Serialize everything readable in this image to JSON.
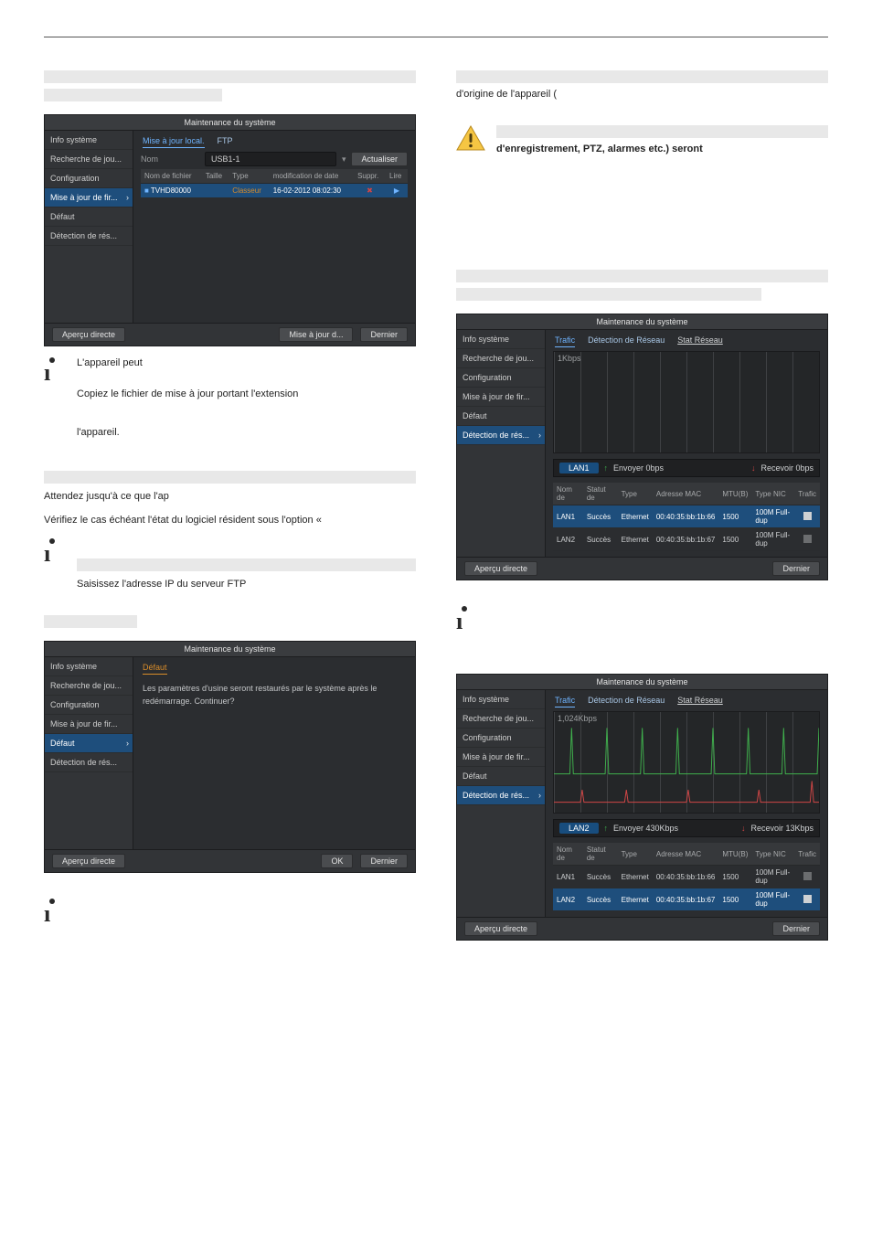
{
  "left": {
    "panel1": {
      "title": "Maintenance du système",
      "sidebar": [
        "Info système",
        "Recherche de jou...",
        "Configuration",
        "Mise à jour de fir...",
        "Défaut",
        "Détection de rés..."
      ],
      "sidebar_active_index": 3,
      "tabs": {
        "local": "Mise à jour local.",
        "ftp": "FTP"
      },
      "fields": {
        "nom_label": "Nom",
        "nom_value": "USB1-1",
        "refresh": "Actualiser"
      },
      "table": {
        "cols": [
          "Nom de fichier",
          "Taille",
          "Type",
          "modification de date",
          "Suppr.",
          "Lire"
        ],
        "row": {
          "name": "TVHD80000",
          "taille": "",
          "type": "Classeur",
          "date": "16-02-2012 08:02:30"
        }
      },
      "footer_left": "Aperçu directe",
      "footer_update": "Mise à jour d...",
      "footer_close": "Dernier"
    },
    "info1": {
      "p1": "L'appareil peut",
      "p2": "Copiez le fichier de mise à jour portant l'extension",
      "p3": "l'appareil."
    },
    "mid": {
      "line1": "Attendez jusqu'à ce que l'ap",
      "line2": "Vérifiez le cas échéant l'état du logiciel résident sous l'option «"
    },
    "info2": {
      "p4": "Saisissez l'adresse IP du serveur FTP"
    },
    "panel2": {
      "title": "Maintenance du système",
      "sidebar": [
        "Info système",
        "Recherche de jou...",
        "Configuration",
        "Mise à jour de fir...",
        "Défaut",
        "Détection de rés..."
      ],
      "sidebar_active_index": 4,
      "tab": "Défaut",
      "msg": "Les paramètres d'usine seront restaurés par le système après le redémarrage. Continuer?",
      "footer_left": "Aperçu directe",
      "ok": "OK",
      "close": "Dernier"
    }
  },
  "right": {
    "top_text": "d'origine de l'appareil (",
    "warn_bold": "d'enregistrement, PTZ, alarmes etc.) seront",
    "panel_net1": {
      "title": "Maintenance du système",
      "sidebar": [
        "Info système",
        "Recherche de jou...",
        "Configuration",
        "Mise à jour de fir...",
        "Défaut",
        "Détection de rés..."
      ],
      "sidebar_active_index": 5,
      "tabs": {
        "a": "Trafic",
        "b": "Détection de Réseau",
        "c": "Stat Réseau"
      },
      "chart_top": "1Kbps",
      "nic": "LAN1",
      "send": "Envoyer 0bps",
      "recv": "Recevoir 0bps",
      "table": {
        "cols": [
          "Nom de",
          "Statut de",
          "Type",
          "Adresse MAC",
          "MTU(B)",
          "Type NIC",
          "Trafic"
        ],
        "rows": [
          {
            "n": "LAN1",
            "s": "Succès",
            "t": "Ethernet",
            "m": "00:40:35:bb:1b:66",
            "mtu": "1500",
            "nic": "100M Full-dup"
          },
          {
            "n": "LAN2",
            "s": "Succès",
            "t": "Ethernet",
            "m": "00:40:35:bb:1b:67",
            "mtu": "1500",
            "nic": "100M Full-dup"
          }
        ]
      },
      "footer_left": "Aperçu directe",
      "close": "Dernier"
    },
    "panel_net2": {
      "title": "Maintenance du système",
      "sidebar": [
        "Info système",
        "Recherche de jou...",
        "Configuration",
        "Mise à jour de fir...",
        "Défaut",
        "Détection de rés..."
      ],
      "sidebar_active_index": 5,
      "tabs": {
        "a": "Trafic",
        "b": "Détection de Réseau",
        "c": "Stat Réseau"
      },
      "chart_top": "1,024Kbps",
      "nic": "LAN2",
      "send": "Envoyer 430Kbps",
      "recv": "Recevoir 13Kbps",
      "table": {
        "cols": [
          "Nom de",
          "Statut de",
          "Type",
          "Adresse MAC",
          "MTU(B)",
          "Type NIC",
          "Trafic"
        ],
        "rows": [
          {
            "n": "LAN1",
            "s": "Succès",
            "t": "Ethernet",
            "m": "00:40:35:bb:1b:66",
            "mtu": "1500",
            "nic": "100M Full-dup"
          },
          {
            "n": "LAN2",
            "s": "Succès",
            "t": "Ethernet",
            "m": "00:40:35:bb:1b:67",
            "mtu": "1500",
            "nic": "100M Full-dup"
          }
        ]
      },
      "footer_left": "Aperçu directe",
      "close": "Dernier"
    }
  }
}
